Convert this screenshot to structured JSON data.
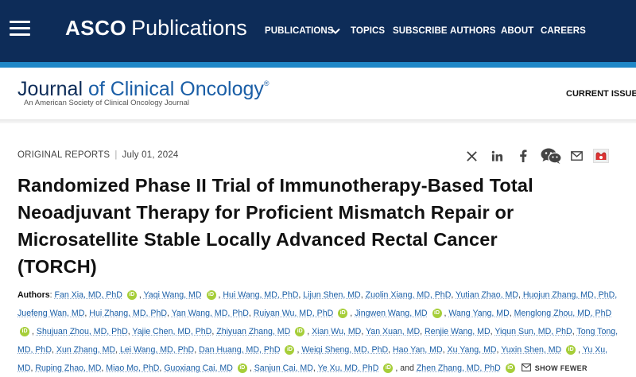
{
  "header": {
    "brand_asco": "ASCO",
    "brand_publications": "Publications",
    "nav": [
      "PUBLICATIONS",
      "TOPICS",
      "SUBSCRIBE",
      "AUTHORS",
      "ABOUT",
      "CAREERS"
    ]
  },
  "journal": {
    "title_journal": "Journal",
    "title_rest": " of Clinical Oncology",
    "registered": "®",
    "subtitle": "An American Society of Clinical Oncology Journal",
    "current_issue": "CURRENT ISSUE"
  },
  "article": {
    "type": "ORIGINAL REPORTS",
    "date": "July 01, 2024",
    "title_lines": [
      "Randomized Phase II Trial of Immunotherapy-Based Total",
      "Neoadjuvant Therapy for Proficient Mismatch Repair or",
      "Microsatellite Stable Locally Advanced Rectal Cancer",
      "(TORCH)"
    ],
    "authors_label": "Authors",
    "orcid_text": "iD",
    "authors": [
      "Fan Xia, MD, PhD",
      "Yaqi Wang, MD",
      "Hui Wang, MD, PhD",
      "Lijun Shen, MD",
      "Zuolin Xiang, MD, PhD",
      "Yutian Zhao, MD",
      "Huojun Zhang, MD, PhD,",
      "Juefeng Wan, MD",
      "Hui Zhang, MD, PhD",
      "Yan Wang, MD, PhD",
      "Ruiyan Wu, MD, PhD",
      "Jingwen Wang, MD",
      "Wang Yang, MD",
      "Menglong Zhou, MD, PhD",
      "Shujuan Zhou, MD, PhD",
      "Yajie Chen, MD, PhD",
      "Zhiyuan Zhang, MD",
      "Xian Wu, MD",
      "Yan Xuan, MD",
      "Renjie Wang, MD",
      "Yiqun Sun, MD, PhD",
      "Tong Tong,",
      "MD, PhD",
      "Xun Zhang, MD",
      "Lei Wang, MD, PhD",
      "Dan Huang, MD, PhD",
      "Weiqi Sheng, MD, PhD",
      "Hao Yan, MD",
      "Xu Yang, MD",
      "Yuxin Shen, MD",
      "Yu Xu,",
      "MD",
      "Ruping Zhao, MD",
      "Miao Mo, PhD",
      "Guoxiang Cai, MD",
      "Sanjun Cai, MD",
      "Ye Xu, MD, PhD",
      "Zhen Zhang, MD, PhD"
    ],
    "and_text": ", and ",
    "show_fewer": "SHOW FEWER"
  },
  "share_icons": [
    "x-twitter-icon",
    "linkedin-icon",
    "facebook-icon",
    "wechat-icon",
    "email-icon",
    "mendeley-icon"
  ],
  "colors": {
    "navy": "#0d2c58",
    "stripe": "#1f87c7",
    "link": "#1a5ea6",
    "orcid": "#a6ce39"
  }
}
